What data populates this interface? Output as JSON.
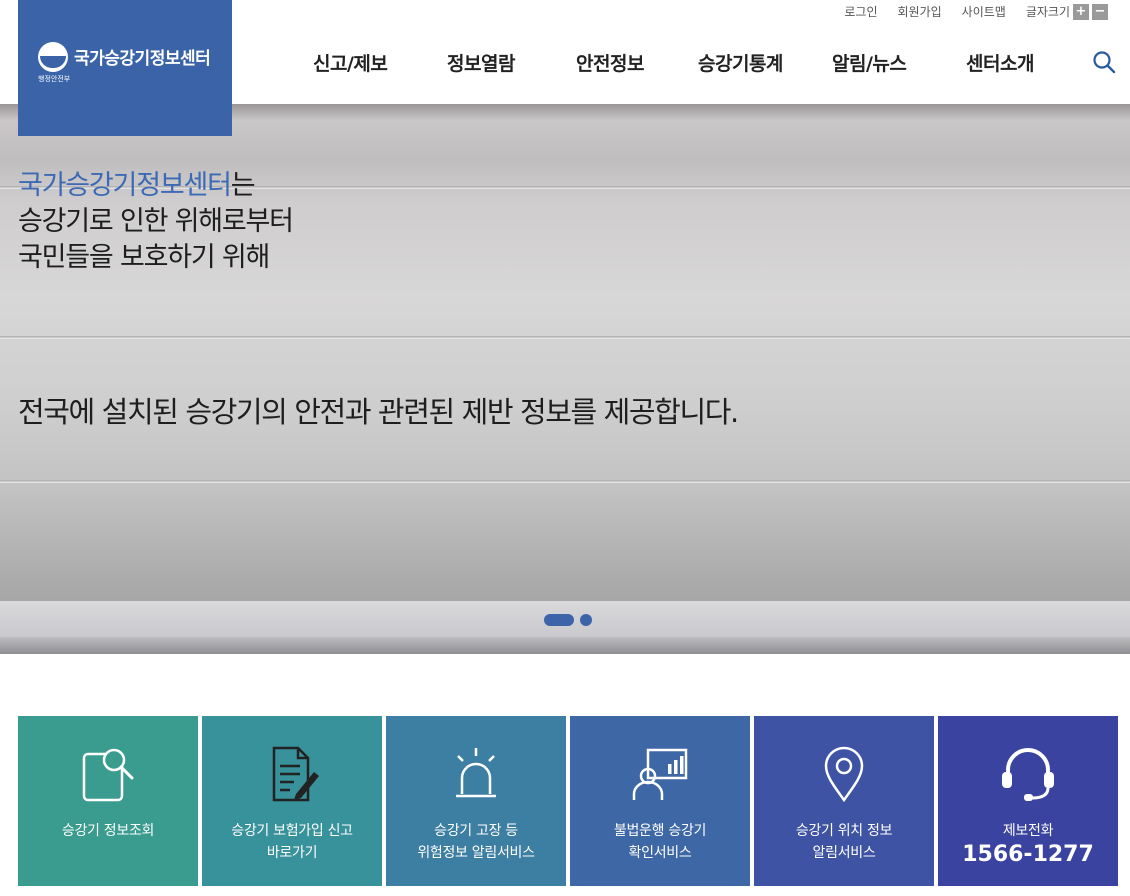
{
  "util": {
    "login": "로그인",
    "join": "회원가입",
    "sitemap": "사이트맵",
    "fontsize": "글자크기",
    "plus": "+",
    "minus": "−"
  },
  "logo": {
    "name": "국가승강기정보센터",
    "ministry": "행정안전부"
  },
  "nav": [
    "신고/제보",
    "정보열람",
    "안전정보",
    "승강기통계",
    "알림/뉴스",
    "센터소개"
  ],
  "hero": {
    "accent": "국가승강기정보센터",
    "line1_suffix": "는",
    "line2": "승강기로 인한 위해로부터",
    "line3": "국민들을 보호하기 위해",
    "line4": "전국에 설치된 승강기의 안전과 관련된 제반 정보를 제공합니다."
  },
  "quick": [
    {
      "line1": "승강기 정보조회",
      "line2": "",
      "color": "#3a9c8f",
      "icon": "document-search-icon"
    },
    {
      "line1": "승강기 보험가입 신고",
      "line2": "바로가기",
      "color": "#38929b",
      "icon": "document-edit-icon"
    },
    {
      "line1": "승강기 고장 등",
      "line2": "위험정보 알림서비스",
      "color": "#3d7ea3",
      "icon": "siren-icon"
    },
    {
      "line1": "불법운행 승강기",
      "line2": "확인서비스",
      "color": "#3e67a6",
      "icon": "presenter-chart-icon"
    },
    {
      "line1": "승강기 위치 정보",
      "line2": "알림서비스",
      "color": "#3e53a3",
      "icon": "location-pin-icon"
    },
    {
      "line1": "제보전화",
      "line2": "1566-1277",
      "color": "#3a44a0",
      "icon": "headset-icon"
    }
  ]
}
